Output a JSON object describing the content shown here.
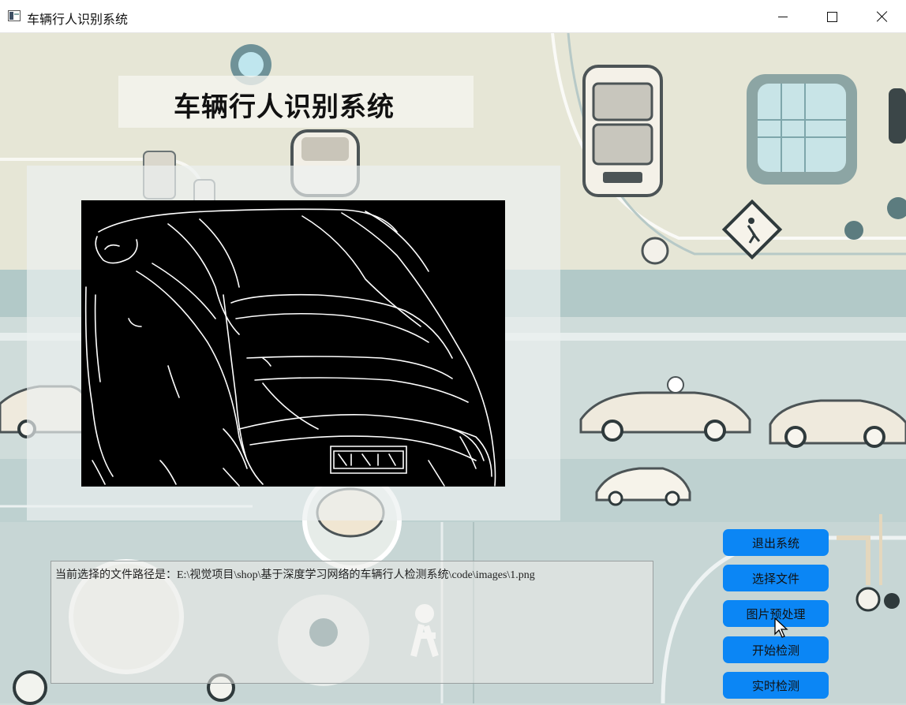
{
  "window": {
    "title": "车辆行人识别系统",
    "controls": [
      "minimize",
      "maximize",
      "close"
    ]
  },
  "header": {
    "system_title": "车辆行人识别系统"
  },
  "preview": {
    "mode": "edge-detected vehicle image"
  },
  "log": {
    "text": "当前选择的文件路径是：E:\\视觉项目\\shop\\基于深度学习网络的车辆行人检测系统\\code\\images\\1.png"
  },
  "buttons": {
    "exit": "退出系统",
    "select_file": "选择文件",
    "preprocess": "图片预处理",
    "start_detect": "开始检测",
    "realtime_detect": "实时检测"
  },
  "colors": {
    "button_bg": "#0b86f5",
    "background_tint": "#c6d8d8",
    "accent_gold": "#e9dcc4"
  },
  "icons": [
    "app-icon",
    "minimize-icon",
    "maximize-icon",
    "close-icon",
    "mouse-cursor-icon"
  ]
}
